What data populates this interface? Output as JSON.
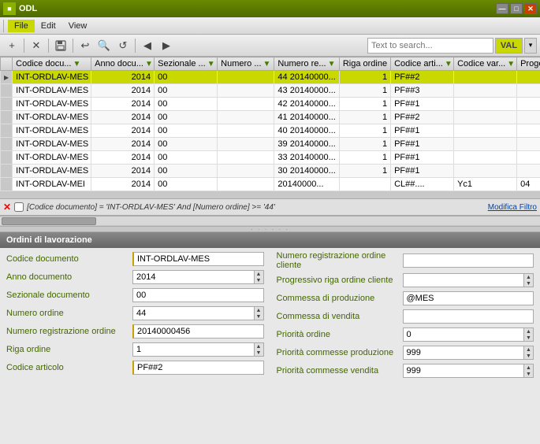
{
  "titleBar": {
    "title": "ODL",
    "minBtn": "—",
    "maxBtn": "□",
    "closeBtn": "✕"
  },
  "menuBar": {
    "items": [
      "File",
      "Edit",
      "View"
    ]
  },
  "toolbar": {
    "searchPlaceholder": "Text to search...",
    "valBtn": "VAL",
    "buttons": [
      "+",
      "✕",
      "💾",
      "↩",
      "🔍",
      "↺",
      "◀",
      "▶"
    ]
  },
  "table": {
    "columns": [
      "Codice docu...",
      "Anno docu...",
      "Sezionale ...",
      "Numero ...",
      "Numero re...",
      "Riga ordine",
      "Codice arti...",
      "Codice var...",
      "Progetto"
    ],
    "rows": [
      {
        "indicator": true,
        "selected": true,
        "codice": "INT-ORDLAV-MES",
        "anno": "2014",
        "sez": "00",
        "numero": "",
        "numReg": "44 20140000...",
        "riga": "1",
        "codArt": "PF##2",
        "codVar": "",
        "progetto": ""
      },
      {
        "indicator": false,
        "selected": false,
        "codice": "INT-ORDLAV-MES",
        "anno": "2014",
        "sez": "00",
        "numero": "",
        "numReg": "43 20140000...",
        "riga": "1",
        "codArt": "PF##3",
        "codVar": "",
        "progetto": ""
      },
      {
        "indicator": false,
        "selected": false,
        "codice": "INT-ORDLAV-MES",
        "anno": "2014",
        "sez": "00",
        "numero": "",
        "numReg": "42 20140000...",
        "riga": "1",
        "codArt": "PF##1",
        "codVar": "",
        "progetto": ""
      },
      {
        "indicator": false,
        "selected": false,
        "codice": "INT-ORDLAV-MES",
        "anno": "2014",
        "sez": "00",
        "numero": "",
        "numReg": "41 20140000...",
        "riga": "1",
        "codArt": "PF##2",
        "codVar": "",
        "progetto": ""
      },
      {
        "indicator": false,
        "selected": false,
        "codice": "INT-ORDLAV-MES",
        "anno": "2014",
        "sez": "00",
        "numero": "",
        "numReg": "40 20140000...",
        "riga": "1",
        "codArt": "PF##1",
        "codVar": "",
        "progetto": ""
      },
      {
        "indicator": false,
        "selected": false,
        "codice": "INT-ORDLAV-MES",
        "anno": "2014",
        "sez": "00",
        "numero": "",
        "numReg": "39 20140000...",
        "riga": "1",
        "codArt": "PF##1",
        "codVar": "",
        "progetto": ""
      },
      {
        "indicator": false,
        "selected": false,
        "codice": "INT-ORDLAV-MES",
        "anno": "2014",
        "sez": "00",
        "numero": "",
        "numReg": "33 20140000...",
        "riga": "1",
        "codArt": "PF##1",
        "codVar": "",
        "progetto": ""
      },
      {
        "indicator": false,
        "selected": false,
        "codice": "INT-ORDLAV-MES",
        "anno": "2014",
        "sez": "00",
        "numero": "",
        "numReg": "30 20140000...",
        "riga": "1",
        "codArt": "PF##1",
        "codVar": "",
        "progetto": ""
      },
      {
        "indicator": false,
        "selected": false,
        "codice": "INT-ORDLAV-MEI",
        "anno": "2014",
        "sez": "00",
        "numero": "",
        "numReg": "20140000...",
        "riga": "",
        "codArt": "CL##....",
        "codVar": "Yc1",
        "progetto": "04"
      }
    ]
  },
  "filterBar": {
    "filterText": "[Codice documento] = 'INT-ORDLAV-MES' And [Numero ordine] >= '44'",
    "modifyLabel": "Modifica Filtro"
  },
  "detail": {
    "header": "Ordini di lavorazione",
    "leftFields": [
      {
        "label": "Codice documento",
        "value": "INT-ORDLAV-MES",
        "highlighted": true
      },
      {
        "label": "Anno documento",
        "value": "2014",
        "spinner": true
      },
      {
        "label": "Sezionale documento",
        "value": "00"
      },
      {
        "label": "Numero ordine",
        "value": "44",
        "spinner": true
      },
      {
        "label": "Numero registrazione ordine",
        "value": "20140000456",
        "highlighted": true
      },
      {
        "label": "Riga ordine",
        "value": "1",
        "spinner": true
      },
      {
        "label": "Codice articolo",
        "value": "PF##2",
        "highlighted": true
      }
    ],
    "rightFields": [
      {
        "label": "Numero registrazione ordine cliente",
        "value": "",
        "highlighted": false
      },
      {
        "label": "Progressivo riga ordine cliente",
        "value": "",
        "spinner": true
      },
      {
        "label": "Commessa di produzione",
        "value": "@MES"
      },
      {
        "label": "Commessa di vendita",
        "value": ""
      },
      {
        "label": "Priorità ordine",
        "value": "0",
        "spinner": true
      },
      {
        "label": "Priorità commesse produzione",
        "value": "999",
        "spinner": true
      },
      {
        "label": "Priorità commesse vendita",
        "value": "999",
        "spinner": true
      }
    ]
  }
}
